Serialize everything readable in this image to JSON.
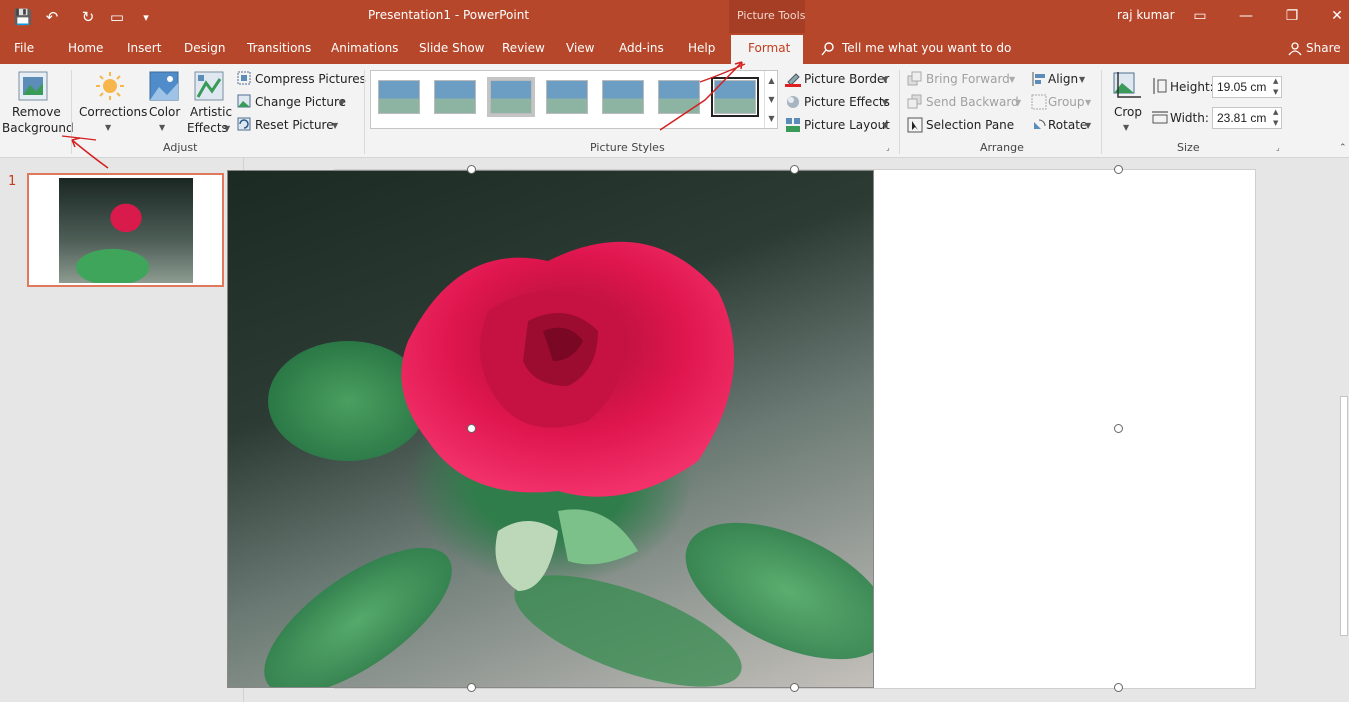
{
  "titlebar": {
    "doc_title": "Presentation1  -  PowerPoint",
    "context_tab_group": "Picture Tools",
    "user": "raj kumar",
    "quick_access": {
      "save": "💾",
      "undo": "↶",
      "redo": "↻",
      "present": "▭",
      "customize": "▾"
    },
    "window_buttons": {
      "ribbon_display": "▭",
      "minimize": "—",
      "restore": "❐",
      "close": "✕"
    }
  },
  "tabs": [
    {
      "label": "File"
    },
    {
      "label": "Home"
    },
    {
      "label": "Insert"
    },
    {
      "label": "Design"
    },
    {
      "label": "Transitions"
    },
    {
      "label": "Animations"
    },
    {
      "label": "Slide Show"
    },
    {
      "label": "Review"
    },
    {
      "label": "View"
    },
    {
      "label": "Add-ins"
    },
    {
      "label": "Help"
    },
    {
      "label": "Format",
      "active": true
    }
  ],
  "tell_me": "Tell me what you want to do",
  "share": "Share",
  "ribbon": {
    "adjust": {
      "group_label": "Adjust",
      "remove_background_1": "Remove",
      "remove_background_2": "Background",
      "corrections": "Corrections",
      "color": "Color",
      "artistic_effects_1": "Artistic",
      "artistic_effects_2": "Effects",
      "compress": "Compress Pictures",
      "change": "Change Picture",
      "reset": "Reset Picture"
    },
    "picture_styles": {
      "group_label": "Picture Styles",
      "border": "Picture Border",
      "effects": "Picture Effects",
      "layout": "Picture Layout"
    },
    "arrange": {
      "group_label": "Arrange",
      "bring_forward": "Bring Forward",
      "send_backward": "Send Backward",
      "selection_pane": "Selection Pane",
      "align": "Align",
      "group": "Group",
      "rotate": "Rotate"
    },
    "size": {
      "group_label": "Size",
      "crop": "Crop",
      "height_label": "Height:",
      "height_value": "19.05 cm",
      "width_label": "Width:",
      "width_value": "23.81 cm"
    }
  },
  "thumbnails": {
    "slide_number": "1"
  },
  "colors": {
    "accent": "#b7472a",
    "format_tab_text": "#c43e1c"
  }
}
